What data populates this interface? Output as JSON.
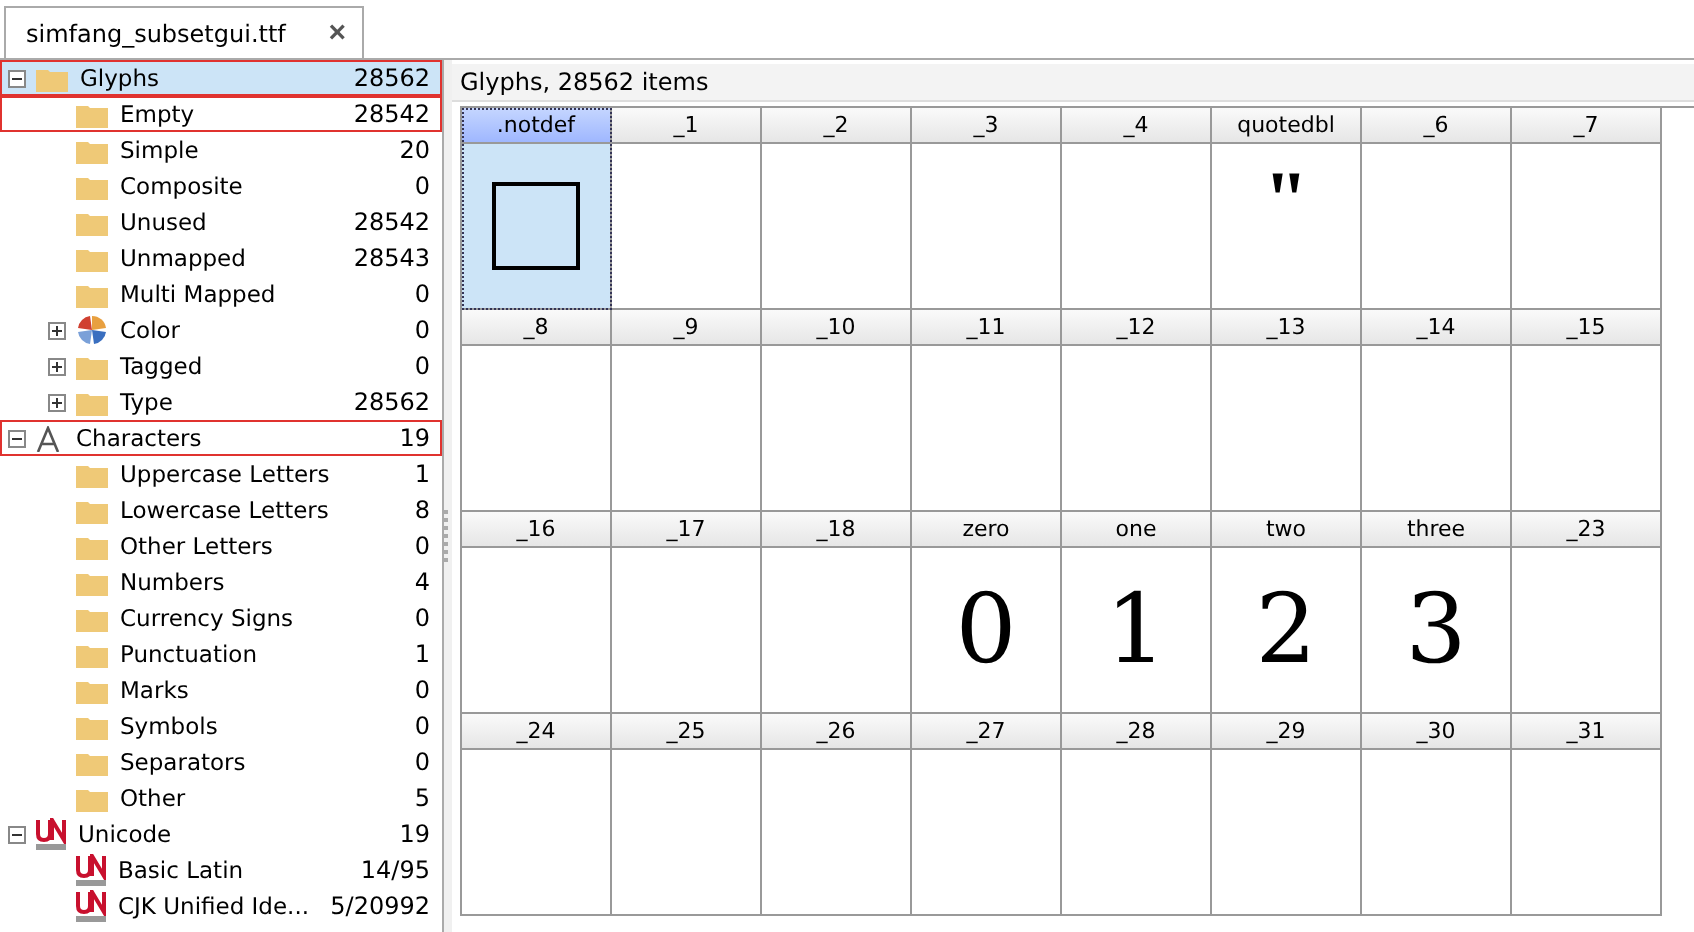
{
  "tab": {
    "title": "simfang_subsetgui.ttf",
    "close": "×"
  },
  "tree": [
    {
      "label": "Glyphs",
      "count": "28562",
      "kind": "folder",
      "selected": true,
      "outlined": true,
      "expanded": true,
      "children": [
        {
          "label": "Empty",
          "count": "28542",
          "kind": "folder",
          "selected": false,
          "outlined": true
        },
        {
          "label": "Simple",
          "count": "20",
          "kind": "folder",
          "selected": false,
          "outlined": false
        },
        {
          "label": "Composite",
          "count": "0",
          "kind": "folder",
          "selected": false,
          "outlined": false
        },
        {
          "label": "Unused",
          "count": "28542",
          "kind": "folder",
          "selected": false,
          "outlined": false
        },
        {
          "label": "Unmapped",
          "count": "28543",
          "kind": "folder",
          "selected": false,
          "outlined": false
        },
        {
          "label": "Multi Mapped",
          "count": "0",
          "kind": "folder",
          "selected": false,
          "outlined": false
        },
        {
          "label": "Color",
          "count": "0",
          "kind": "color",
          "selected": false,
          "outlined": false,
          "expanded": false
        },
        {
          "label": "Tagged",
          "count": "0",
          "kind": "folder",
          "selected": false,
          "outlined": false,
          "expanded": false
        },
        {
          "label": "Type",
          "count": "28562",
          "kind": "folder",
          "selected": false,
          "outlined": false,
          "expanded": false
        }
      ]
    },
    {
      "label": "Characters",
      "count": "19",
      "kind": "letter",
      "selected": false,
      "outlined": true,
      "expanded": true,
      "children": [
        {
          "label": "Uppercase Letters",
          "count": "1",
          "kind": "folder",
          "selected": false,
          "outlined": false
        },
        {
          "label": "Lowercase Letters",
          "count": "8",
          "kind": "folder",
          "selected": false,
          "outlined": false
        },
        {
          "label": "Other Letters",
          "count": "0",
          "kind": "folder",
          "selected": false,
          "outlined": false
        },
        {
          "label": "Numbers",
          "count": "4",
          "kind": "folder",
          "selected": false,
          "outlined": false
        },
        {
          "label": "Currency Signs",
          "count": "0",
          "kind": "folder",
          "selected": false,
          "outlined": false
        },
        {
          "label": "Punctuation",
          "count": "1",
          "kind": "folder",
          "selected": false,
          "outlined": false
        },
        {
          "label": "Marks",
          "count": "0",
          "kind": "folder",
          "selected": false,
          "outlined": false
        },
        {
          "label": "Symbols",
          "count": "0",
          "kind": "folder",
          "selected": false,
          "outlined": false
        },
        {
          "label": "Separators",
          "count": "0",
          "kind": "folder",
          "selected": false,
          "outlined": false
        },
        {
          "label": "Other",
          "count": "5",
          "kind": "folder",
          "selected": false,
          "outlined": false
        }
      ]
    },
    {
      "label": "Unicode",
      "count": "19",
      "kind": "unicode",
      "selected": false,
      "outlined": false,
      "expanded": true,
      "children": [
        {
          "label": "Basic Latin",
          "count": "14/95",
          "kind": "unicode",
          "selected": false,
          "outlined": false
        },
        {
          "label": "CJK Unified Ide...",
          "count": "5/20992",
          "kind": "unicode",
          "selected": false,
          "outlined": false
        }
      ]
    }
  ],
  "grid": {
    "header": "Glyphs, 28562 items",
    "cells": [
      {
        "name": ".notdef",
        "kind": "notdef",
        "selected": true
      },
      {
        "name": "_1",
        "kind": "empty",
        "selected": false
      },
      {
        "name": "_2",
        "kind": "empty",
        "selected": false
      },
      {
        "name": "_3",
        "kind": "empty",
        "selected": false
      },
      {
        "name": "_4",
        "kind": "empty",
        "selected": false
      },
      {
        "name": "quotedbl",
        "kind": "char",
        "glyph": "\"",
        "selected": false
      },
      {
        "name": "_6",
        "kind": "empty",
        "selected": false
      },
      {
        "name": "_7",
        "kind": "empty",
        "selected": false
      },
      {
        "name": "_8",
        "kind": "empty",
        "selected": false
      },
      {
        "name": "_9",
        "kind": "empty",
        "selected": false
      },
      {
        "name": "_10",
        "kind": "empty",
        "selected": false
      },
      {
        "name": "_11",
        "kind": "empty",
        "selected": false
      },
      {
        "name": "_12",
        "kind": "empty",
        "selected": false
      },
      {
        "name": "_13",
        "kind": "empty",
        "selected": false
      },
      {
        "name": "_14",
        "kind": "empty",
        "selected": false
      },
      {
        "name": "_15",
        "kind": "empty",
        "selected": false
      },
      {
        "name": "_16",
        "kind": "empty",
        "selected": false
      },
      {
        "name": "_17",
        "kind": "empty",
        "selected": false
      },
      {
        "name": "_18",
        "kind": "empty",
        "selected": false
      },
      {
        "name": "zero",
        "kind": "char",
        "glyph": "0",
        "selected": false
      },
      {
        "name": "one",
        "kind": "char",
        "glyph": "1",
        "selected": false
      },
      {
        "name": "two",
        "kind": "char",
        "glyph": "2",
        "selected": false
      },
      {
        "name": "three",
        "kind": "char",
        "glyph": "3",
        "selected": false
      },
      {
        "name": "_23",
        "kind": "empty",
        "selected": false
      },
      {
        "name": "_24",
        "kind": "empty",
        "selected": false
      },
      {
        "name": "_25",
        "kind": "empty",
        "selected": false
      },
      {
        "name": "_26",
        "kind": "empty",
        "selected": false
      },
      {
        "name": "_27",
        "kind": "empty",
        "selected": false
      },
      {
        "name": "_28",
        "kind": "empty",
        "selected": false
      },
      {
        "name": "_29",
        "kind": "empty",
        "selected": false
      },
      {
        "name": "_30",
        "kind": "empty",
        "selected": false
      },
      {
        "name": "_31",
        "kind": "empty",
        "selected": false
      }
    ]
  }
}
